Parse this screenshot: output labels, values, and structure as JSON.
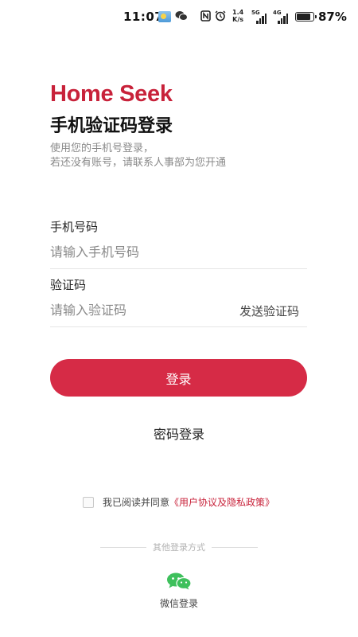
{
  "status_bar": {
    "time": "11:07",
    "speed_top": "1.4",
    "speed_bottom": "K/s",
    "signal1_tag": "5G",
    "signal2_tag": "4G",
    "battery_percent": "87%",
    "battery_level": 0.87,
    "icons": [
      "weather-icon",
      "wechat-notification-icon",
      "nfc-icon",
      "alarm-icon",
      "signal-icon",
      "battery-icon"
    ]
  },
  "header": {
    "brand": "Home Seek",
    "title": "手机验证码登录",
    "hint_line1": "使用您的手机号登录，",
    "hint_line2": "若还没有账号，请联系人事部为您开通"
  },
  "form": {
    "phone_label": "手机号码",
    "phone_placeholder": "请输入手机号码",
    "phone_value": "",
    "code_label": "验证码",
    "code_placeholder": "请输入验证码",
    "code_value": "",
    "send_code_label": "发送验证码"
  },
  "actions": {
    "login_label": "登录",
    "password_login_label": "密码登录"
  },
  "agreement": {
    "checked": false,
    "text": "我已阅读并同意",
    "link_text": "《用户协议及隐私政策》"
  },
  "other_login": {
    "divider_text": "其他登录方式",
    "wechat_label": "微信登录"
  },
  "colors": {
    "accent": "#d62b46",
    "brand": "#c8223a",
    "wechat": "#3ec05c"
  }
}
